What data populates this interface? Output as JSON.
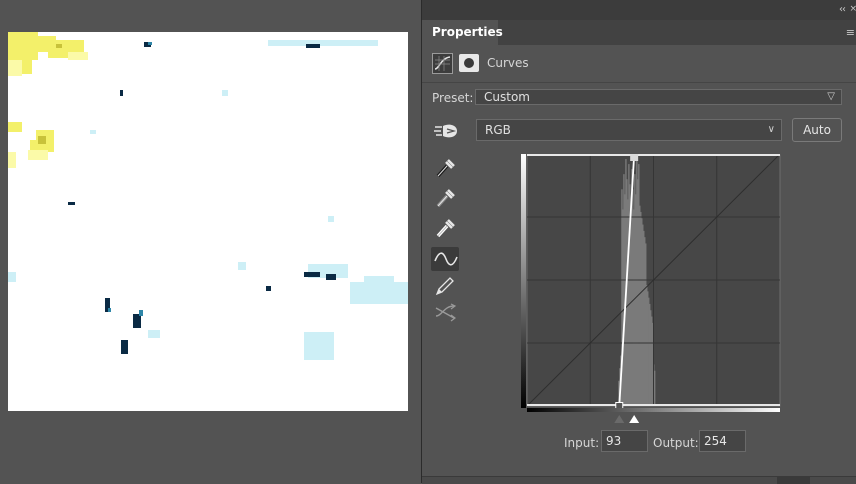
{
  "panel": {
    "tab_label": "Properties",
    "adjustment_title": "Curves"
  },
  "preset": {
    "label": "Preset:",
    "value": "Custom"
  },
  "channel": {
    "value": "RGB"
  },
  "auto_button_label": "Auto",
  "io": {
    "input_label": "Input:",
    "input_value": "93",
    "output_label": "Output:",
    "output_value": "254"
  },
  "curve_points": [
    [
      93,
      0
    ],
    [
      108,
      254
    ]
  ],
  "levels": {
    "black_input": 93,
    "white_input": 108
  },
  "tools": [
    "target-adjust-icon",
    "black-eyedropper-icon",
    "gray-eyedropper-icon",
    "white-eyedropper-icon",
    "curve-edit-icon",
    "pencil-icon",
    "smooth-icon"
  ],
  "colors": {
    "panel_bg": "#535353",
    "graph_bg": "#474747",
    "histogram": "#7a7a7a",
    "curve": "#ffffff"
  }
}
